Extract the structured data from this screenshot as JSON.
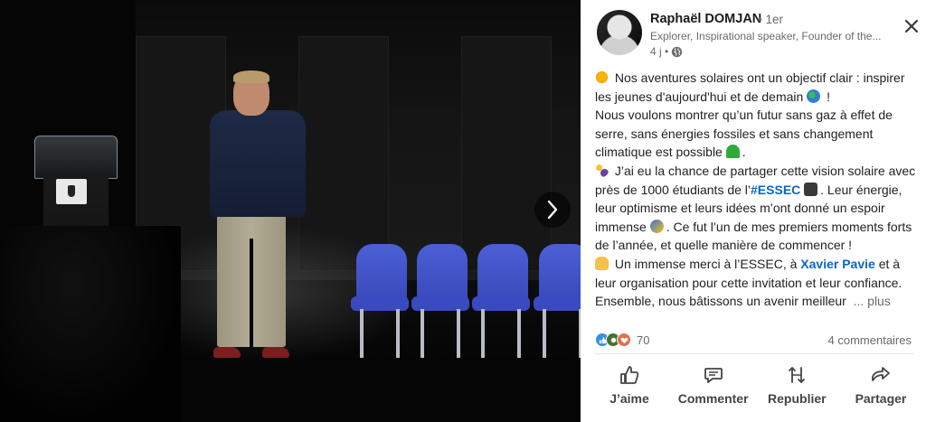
{
  "post": {
    "author": {
      "name": "Raphaël DOMJAN",
      "degree": "• 1er",
      "headline": "Explorer, Inspirational speaker, Founder of the...",
      "time": "4 j •"
    },
    "text": {
      "l1": "Nos aventures solaires ont un objectif clair : inspirer les jeunes d'aujourd'hui et de demain",
      "l1_end": " !",
      "l2": "Nous voulons montrer qu’un futur sans gaz à effet de serre, sans énergies fossiles et sans changement climatique est possible",
      "l2_end": ".",
      "l3_pre": "J’ai eu la chance de partager cette vision solaire avec près de 1000 étudiants de l’",
      "hashtag": "#ESSEC",
      "l3_mid": ". Leur énergie, leur optimisme et leurs idées m’ont donné un espoir immense",
      "l3_end": ". Ce fut l’un de mes premiers moments forts de l’année, et quelle manière de commencer !",
      "l4_pre": "Un immense merci à l’ESSEC, à ",
      "mention": "Xavier Pavie",
      "l4_end": " et à leur organisation pour cette invitation et leur confiance. Ensemble, nous bâtissons un avenir meilleur",
      "more": "... plus"
    },
    "reactions": {
      "count": "70",
      "comments": "4 commentaires"
    },
    "actions": {
      "like": "J’aime",
      "comment": "Commenter",
      "repost": "Republier",
      "share": "Partager"
    }
  },
  "colors": {
    "link": "#0a66c2",
    "muted": "#6b6b6b",
    "like_blue": "#378fe9",
    "celebrate_green": "#44712e",
    "love_red": "#df704d",
    "chair_blue": "#3f51c8"
  },
  "icons": [
    "sun-emoji",
    "globe-emoji",
    "green-heart-emoji",
    "sparkles-emoji",
    "graduation-cap-emoji",
    "rocket-emoji",
    "folded-hands-emoji",
    "globe-icon",
    "close-icon",
    "chevron-right-icon",
    "like-icon",
    "comment-icon",
    "repost-icon",
    "send-icon"
  ]
}
